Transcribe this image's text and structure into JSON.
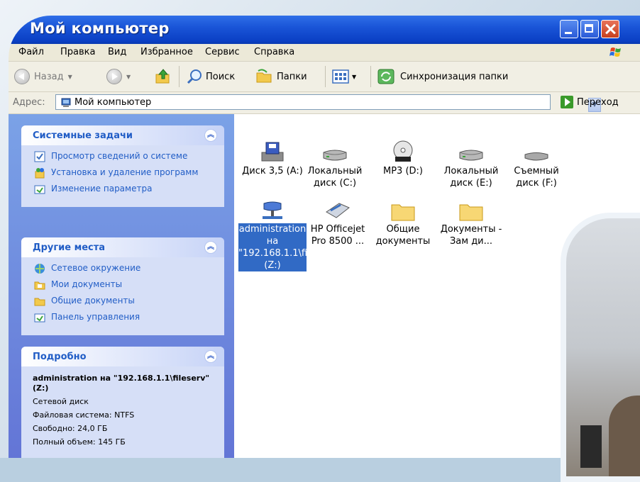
{
  "window": {
    "title": "Мой компьютер"
  },
  "menu": [
    "Файл",
    "Правка",
    "Вид",
    "Избранное",
    "Сервис",
    "Справка"
  ],
  "toolbar": {
    "back_label": "Назад",
    "search_label": "Поиск",
    "folders_label": "Папки",
    "sync_label": "Синхронизация папки"
  },
  "address": {
    "label": "Адрес:",
    "value": "Мой компьютер",
    "go_label": "Переход"
  },
  "system_tasks": {
    "title": "Системные задачи",
    "items": [
      "Просмотр сведений о системе",
      "Установка и удаление программ",
      "Изменение параметра"
    ]
  },
  "other_places": {
    "title": "Другие места",
    "items": [
      "Сетевое окружение",
      "Мои документы",
      "Общие документы",
      "Панель управления"
    ]
  },
  "details": {
    "title": "Подробно",
    "name": "administration на \"192.168.1.1\\fileserv\" (Z:)",
    "type": "Сетевой диск",
    "filesystem": "Файловая система: NTFS",
    "free": "Свободно: 24,0 ГБ",
    "total": "Полный объем: 145 ГБ"
  },
  "items": [
    {
      "label": "Диск 3,5 (A:)",
      "icon": "floppy-icon"
    },
    {
      "label": "Локальный диск (C:)",
      "icon": "hard-drive-icon"
    },
    {
      "label": "MP3 (D:)",
      "icon": "cdrom-icon"
    },
    {
      "label": "Локальный диск (E:)",
      "icon": "hard-drive-icon"
    },
    {
      "label": "Съемный диск (F:)",
      "icon": "removable-drive-icon"
    },
    {
      "label": "administration на \"192.168.1.1\\fileserv\" (Z:)",
      "icon": "network-drive-icon",
      "selected": true
    },
    {
      "label": "HP Officejet Pro 8500 ...",
      "icon": "scanner-icon"
    },
    {
      "label": "Общие документы",
      "icon": "folder-icon"
    },
    {
      "label": "Документы - Зам ди...",
      "icon": "folder-icon"
    }
  ],
  "colors": {
    "title_bar": "#0a3fc4",
    "task_link": "#215dc6",
    "selection": "#316ac5"
  }
}
